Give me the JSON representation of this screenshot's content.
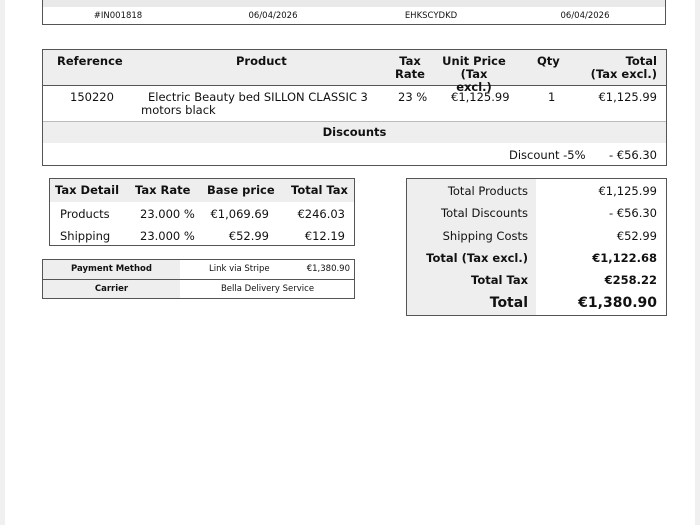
{
  "top_row": {
    "invoice_number": "#IN001818",
    "invoice_date": "06/04/2026",
    "order_reference": "EHKSCYDKD",
    "order_date": "06/04/2026"
  },
  "products_table": {
    "headers": {
      "reference": "Reference",
      "product": "Product",
      "tax_rate_1": "Tax",
      "tax_rate_2": "Rate",
      "unit_price_1": "Unit Price",
      "unit_price_2": "(Tax excl.)",
      "qty": "Qty",
      "total_1": "Total",
      "total_2": "(Tax excl.)"
    },
    "rows": [
      {
        "reference": "150220",
        "product_line1": "Electric Beauty bed SILLON CLASSIC 3",
        "product_line2": "motors black",
        "tax_rate": "23 %",
        "unit_price": "€1,125.99",
        "qty": "1",
        "total": "€1,125.99"
      }
    ],
    "discounts_title": "Discounts",
    "discount": {
      "label": "Discount -5%",
      "amount": "- €56.30"
    }
  },
  "tax_detail": {
    "headers": [
      "Tax Detail",
      "Tax Rate",
      "Base price",
      "Total Tax"
    ],
    "rows": [
      [
        "Products",
        "23.000 %",
        "€1,069.69",
        "€246.03"
      ],
      [
        "Shipping",
        "23.000 %",
        "€52.99",
        "€12.19"
      ]
    ]
  },
  "payment": {
    "method_label": "Payment Method",
    "method_value": "Link via Stripe",
    "method_amount": "€1,380.90",
    "carrier_label": "Carrier",
    "carrier_value": "Bella Delivery Service"
  },
  "totals": [
    {
      "label": "Total Products",
      "value": "€1,125.99"
    },
    {
      "label": "Total Discounts",
      "value": "- €56.30"
    },
    {
      "label": "Shipping Costs",
      "value": "€52.99"
    },
    {
      "label": "Total (Tax excl.)",
      "value": "€1,122.68"
    },
    {
      "label": "Total Tax",
      "value": "€258.22"
    },
    {
      "label": "Total",
      "value": "€1,380.90"
    }
  ]
}
